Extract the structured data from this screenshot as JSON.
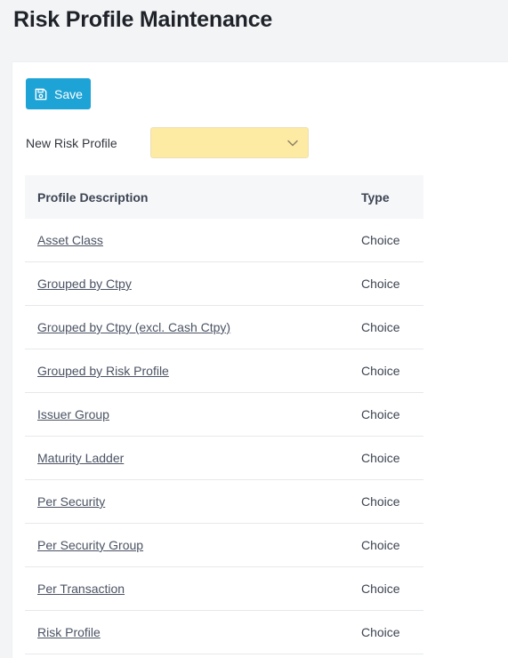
{
  "page": {
    "title": "Risk Profile Maintenance"
  },
  "toolbar": {
    "save_label": "Save",
    "save_icon": "floppy-disk-icon"
  },
  "form": {
    "new_risk_profile_label": "New Risk Profile",
    "new_risk_profile_value": ""
  },
  "grid": {
    "columns": {
      "description": "Profile Description",
      "type": "Type"
    },
    "rows": [
      {
        "description": "Asset Class",
        "type": "Choice"
      },
      {
        "description": "Grouped by Ctpy",
        "type": "Choice"
      },
      {
        "description": "Grouped by Ctpy (excl. Cash Ctpy)",
        "type": "Choice"
      },
      {
        "description": "Grouped by Risk Profile",
        "type": "Choice"
      },
      {
        "description": "Issuer Group",
        "type": "Choice"
      },
      {
        "description": "Maturity Ladder",
        "type": "Choice"
      },
      {
        "description": "Per Security",
        "type": "Choice"
      },
      {
        "description": "Per Security Group",
        "type": "Choice"
      },
      {
        "description": "Per Transaction",
        "type": "Choice"
      },
      {
        "description": "Risk Profile",
        "type": "Choice"
      }
    ]
  },
  "colors": {
    "accent": "#1ea3d6",
    "select_bg": "#fdeaa3",
    "header_bg": "#f6f7f9"
  }
}
